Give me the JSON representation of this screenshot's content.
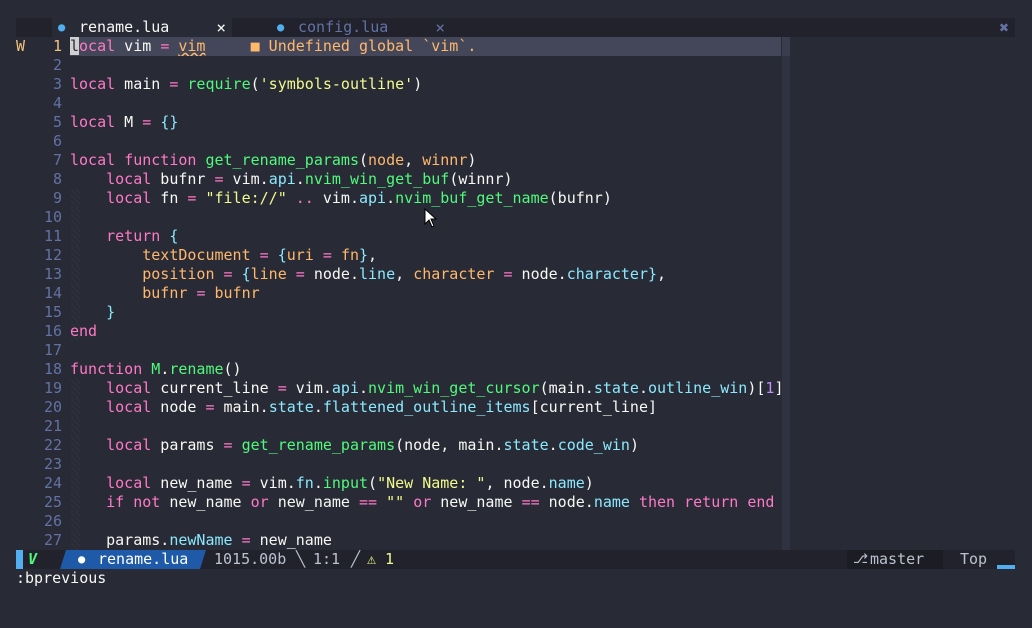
{
  "tabs": [
    {
      "label": "rename.lua",
      "active": true
    },
    {
      "label": "config.lua",
      "active": false
    }
  ],
  "tab_close_glyph": "×",
  "tabline_close_all": "✖",
  "icons": {
    "file": "lua-file-icon",
    "branch": "git-branch-icon",
    "warning": "warning-icon"
  },
  "editor": {
    "diagnostic": {
      "sign": "W",
      "square": "■",
      "message": "Undefined global `vim`."
    },
    "lines": [
      {
        "n": "1",
        "html": "<span class=\"cursor\">l</span><span class=\"kw\">ocal</span> vim <span class=\"op\">=</span> <span class=\"vtext diag-under\">vim</span>     <span class=\"diag-sq\">■ Undefined global `vim`.</span>"
      },
      {
        "n": "2",
        "html": ""
      },
      {
        "n": "3",
        "html": "<span class=\"kw\">local</span> main <span class=\"op\">=</span> <span class=\"fn\">require</span>(<span class=\"str\">'symbols-outline'</span>)"
      },
      {
        "n": "4",
        "html": ""
      },
      {
        "n": "5",
        "html": "<span class=\"kw\">local</span> M <span class=\"op\">=</span> <span class=\"fld\">{}</span>"
      },
      {
        "n": "6",
        "html": ""
      },
      {
        "n": "7",
        "html": "<span class=\"kw\">local</span> <span class=\"kw\">function</span> <span class=\"fn\">get_rename_params</span>(<span class=\"var\">node</span>, <span class=\"var\">winnr</span>)"
      },
      {
        "n": "8",
        "html": "    <span class=\"kw\">local</span> bufnr <span class=\"op\">=</span> vim.<span class=\"fld\">api</span>.<span class=\"fn\">nvim_win_get_buf</span>(winnr)"
      },
      {
        "n": "9",
        "html": "    <span class=\"kw\">local</span> fn <span class=\"op\">=</span> <span class=\"str\">\"file://\"</span> <span class=\"op\">..</span> vim.<span class=\"fld\">api</span>.<span class=\"fn\">nvim_buf_get_name</span>(bufnr)"
      },
      {
        "n": "10",
        "html": ""
      },
      {
        "n": "11",
        "html": "    <span class=\"kw\">return</span> <span class=\"fld\">{</span>"
      },
      {
        "n": "12",
        "html": "        <span class=\"var\">textDocument</span> <span class=\"op\">=</span> <span class=\"fld\">{</span><span class=\"var\">uri</span> <span class=\"op\">=</span> <span class=\"var\">fn</span><span class=\"fld\">}</span>,"
      },
      {
        "n": "13",
        "html": "        <span class=\"var\">position</span> <span class=\"op\">=</span> <span class=\"fld\">{</span><span class=\"var\">line</span> <span class=\"op\">=</span> node.<span class=\"fld\">line</span>, <span class=\"var\">character</span> <span class=\"op\">=</span> node.<span class=\"fld\">character</span><span class=\"fld\">}</span>,"
      },
      {
        "n": "14",
        "html": "        <span class=\"var\">bufnr</span> <span class=\"op\">=</span> <span class=\"var\">bufnr</span>"
      },
      {
        "n": "15",
        "html": "    <span class=\"fld\">}</span>"
      },
      {
        "n": "16",
        "html": "<span class=\"kw\">end</span>"
      },
      {
        "n": "17",
        "html": ""
      },
      {
        "n": "18",
        "html": "<span class=\"kw\">function</span> <span class=\"fn\">M</span>.<span class=\"fn\">rename</span>()"
      },
      {
        "n": "19",
        "html": "    <span class=\"kw\">local</span> current_line <span class=\"op\">=</span> vim.<span class=\"fld\">api</span>.<span class=\"fn\">nvim_win_get_cursor</span>(main.<span class=\"fld\">state</span>.<span class=\"fld\">outline_win</span>)[<span class=\"num\">1</span>]"
      },
      {
        "n": "20",
        "html": "    <span class=\"kw\">local</span> node <span class=\"op\">=</span> main.<span class=\"fld\">state</span>.<span class=\"fld\">flattened_outline_items</span>[current_line]"
      },
      {
        "n": "21",
        "html": ""
      },
      {
        "n": "22",
        "html": "    <span class=\"kw\">local</span> params <span class=\"op\">=</span> <span class=\"fn\">get_rename_params</span>(node, main.<span class=\"fld\">state</span>.<span class=\"fld\">code_win</span>)"
      },
      {
        "n": "23",
        "html": ""
      },
      {
        "n": "24",
        "html": "    <span class=\"kw\">local</span> new_name <span class=\"op\">=</span> vim.<span class=\"fld\">fn</span>.<span class=\"fn\">input</span>(<span class=\"str\">\"New Name: \"</span>, node.<span class=\"fld\">name</span>)"
      },
      {
        "n": "25",
        "html": "    <span class=\"kw\">if</span> <span class=\"kw\">not</span> new_name <span class=\"kw\">or</span> new_name <span class=\"op\">==</span> <span class=\"str\">\"\"</span> <span class=\"kw\">or</span> new_name <span class=\"op\">==</span> node.<span class=\"fld\">name</span> <span class=\"kw\">then</span> <span class=\"kw\">return</span> <span class=\"kw\">end</span>"
      },
      {
        "n": "26",
        "html": ""
      },
      {
        "n": "27",
        "html": "    params.<span class=\"fld\">newName</span> <span class=\"op\">=</span> new_name"
      }
    ]
  },
  "statusline": {
    "mode_glyph": "V",
    "filename": "rename.lua",
    "filesize": "1015.00b",
    "position": "1:1",
    "sep_left": "╲",
    "sep_right": "╱",
    "warning_glyph": "⚠",
    "warning_count": "1",
    "branch": "master",
    "scroll": "Top"
  },
  "cmdline": ":bprevious"
}
